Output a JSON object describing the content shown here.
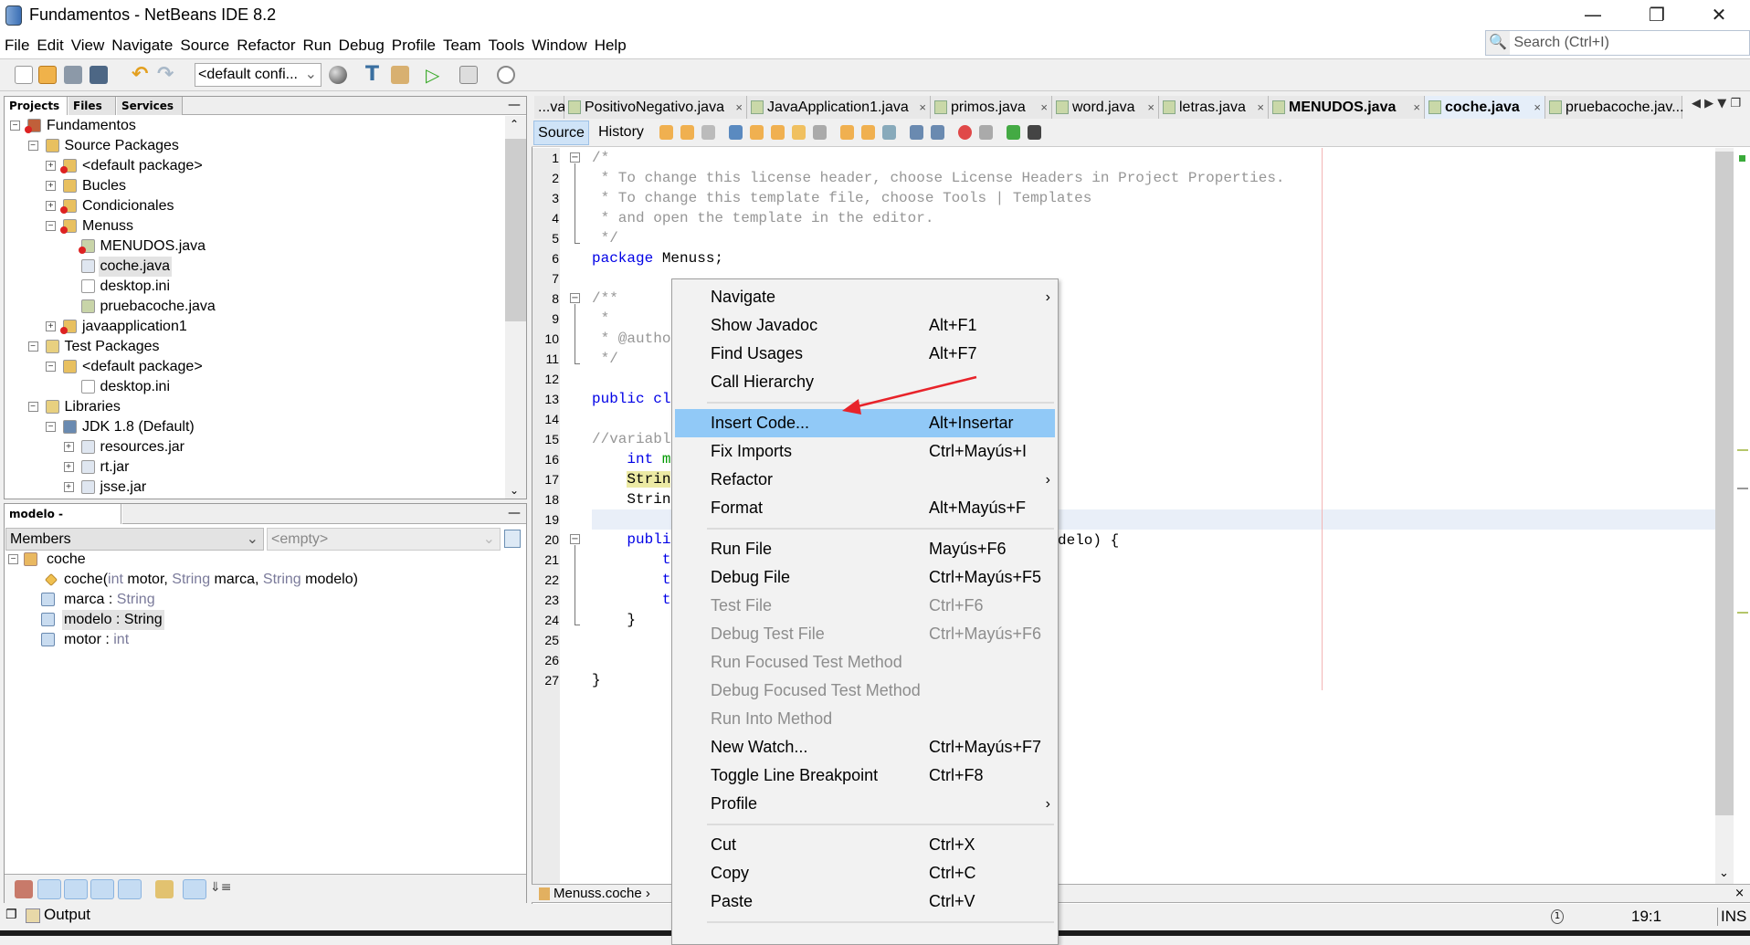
{
  "window": {
    "title": "Fundamentos - NetBeans IDE 8.2",
    "controls": [
      "minimize-icon",
      "restore-icon",
      "close-icon"
    ]
  },
  "menubar": [
    "File",
    "Edit",
    "View",
    "Navigate",
    "Source",
    "Refactor",
    "Run",
    "Debug",
    "Profile",
    "Team",
    "Tools",
    "Window",
    "Help"
  ],
  "search": {
    "placeholder": "Search (Ctrl+I)"
  },
  "toolbar": {
    "config": "<default confi..."
  },
  "projects_panel": {
    "tabs": [
      "Projects",
      "Files",
      "Services"
    ],
    "tree": [
      {
        "label": "Fundamentos",
        "depth": 0,
        "expander": "minus",
        "icon": "project"
      },
      {
        "label": "Source Packages",
        "depth": 1,
        "expander": "minus",
        "icon": "source-folder"
      },
      {
        "label": "<default package>",
        "depth": 2,
        "expander": "plus",
        "icon": "package-error"
      },
      {
        "label": "Bucles",
        "depth": 2,
        "expander": "plus",
        "icon": "package"
      },
      {
        "label": "Condicionales",
        "depth": 2,
        "expander": "plus",
        "icon": "package-error"
      },
      {
        "label": "Menuss",
        "depth": 2,
        "expander": "minus",
        "icon": "package-error"
      },
      {
        "label": "MENUDOS.java",
        "depth": 3,
        "expander": "",
        "icon": "java-main-error"
      },
      {
        "label": "coche.java",
        "depth": 3,
        "expander": "",
        "icon": "java-class",
        "selected": true
      },
      {
        "label": "desktop.ini",
        "depth": 3,
        "expander": "",
        "icon": "ini-file"
      },
      {
        "label": "pruebacoche.java",
        "depth": 3,
        "expander": "",
        "icon": "java-main"
      },
      {
        "label": "javaapplication1",
        "depth": 2,
        "expander": "plus",
        "icon": "package-error"
      },
      {
        "label": "Test Packages",
        "depth": 1,
        "expander": "minus",
        "icon": "test-folder"
      },
      {
        "label": "<default package>",
        "depth": 2,
        "expander": "minus",
        "icon": "package"
      },
      {
        "label": "desktop.ini",
        "depth": 3,
        "expander": "",
        "icon": "ini-file"
      },
      {
        "label": "Libraries",
        "depth": 1,
        "expander": "minus",
        "icon": "library-folder"
      },
      {
        "label": "JDK 1.8 (Default)",
        "depth": 2,
        "expander": "minus",
        "icon": "jdk"
      },
      {
        "label": "resources.jar",
        "depth": 3,
        "expander": "plus",
        "icon": "jar"
      },
      {
        "label": "rt.jar",
        "depth": 3,
        "expander": "plus",
        "icon": "jar"
      },
      {
        "label": "jsse.jar",
        "depth": 3,
        "expander": "plus",
        "icon": "jar"
      }
    ]
  },
  "navigator": {
    "tab": "modelo - Navigator",
    "filter": "Members",
    "second_combo": "<empty>",
    "tree": [
      {
        "name": "coche",
        "type": ""
      },
      {
        "name": "coche(",
        "type": "",
        "sig": [
          [
            "int",
            "g"
          ],
          [
            " motor, ",
            "b"
          ],
          [
            "String",
            "g"
          ],
          [
            " marca, ",
            "b"
          ],
          [
            "String",
            "g"
          ],
          [
            " modelo)",
            "b"
          ]
        ]
      },
      {
        "name": "marca",
        "type": "String"
      },
      {
        "name": "modelo",
        "type": "String",
        "selected": true
      },
      {
        "name": "motor",
        "type": "int"
      }
    ]
  },
  "output": {
    "label": "Output"
  },
  "editor": {
    "tabs": [
      {
        "label": "...va"
      },
      {
        "label": "PositivoNegativo.java"
      },
      {
        "label": "JavaApplication1.java"
      },
      {
        "label": "primos.java"
      },
      {
        "label": "word.java"
      },
      {
        "label": "letras.java"
      },
      {
        "label": "MENUDOS.java",
        "bold": true
      },
      {
        "label": "coche.java",
        "active": true
      },
      {
        "label": "pruebacoche.jav..."
      }
    ],
    "source_tab": "Source",
    "history_tab": "History",
    "lines": [
      [
        [
          "/*",
          "cm"
        ]
      ],
      [
        [
          " * To change this license header, choose License Headers in Project Properties.",
          "cm"
        ]
      ],
      [
        [
          " * To change this template file, choose Tools | Templates",
          "cm"
        ]
      ],
      [
        [
          " * and open the template in the editor.",
          "cm"
        ]
      ],
      [
        [
          " */",
          "cm"
        ]
      ],
      [
        [
          "package",
          "kw"
        ],
        [
          " Menuss;",
          ""
        ]
      ],
      [],
      [
        [
          "/**",
          "cm"
        ]
      ],
      [
        [
          " *",
          "cm"
        ]
      ],
      [
        [
          " * @autho",
          "cm"
        ]
      ],
      [
        [
          " */",
          "cm"
        ]
      ],
      [],
      [
        [
          "public cl",
          "kw"
        ]
      ],
      [],
      [
        [
          "//variabl",
          "cm"
        ]
      ],
      [
        [
          "    ",
          ""
        ],
        [
          "int",
          "kw"
        ],
        [
          " m",
          "fd"
        ]
      ],
      [
        [
          "    ",
          ""
        ],
        [
          "Strin",
          "hlw"
        ]
      ],
      [
        [
          "    Strin",
          ""
        ]
      ],
      [],
      [
        [
          "    ",
          ""
        ],
        [
          "publi",
          "kw"
        ]
      ],
      [
        [
          "        ",
          ""
        ],
        [
          "t",
          "kw"
        ]
      ],
      [
        [
          "        ",
          ""
        ],
        [
          "t",
          "kw"
        ]
      ],
      [
        [
          "        ",
          ""
        ],
        [
          "t",
          "kw"
        ]
      ],
      [
        [
          "    }",
          ""
        ]
      ],
      [],
      [],
      [
        [
          "}",
          ""
        ]
      ]
    ],
    "line20_tail": "delo) {",
    "current_line": 19,
    "breadcrumb": "Menuss.coche"
  },
  "status": {
    "position": "19:1",
    "mode": "INS",
    "notifications": "1"
  },
  "context_menu": [
    {
      "label": "Navigate",
      "submenu": true
    },
    {
      "label": "Show Javadoc",
      "shortcut": "Alt+F1"
    },
    {
      "label": "Find Usages",
      "shortcut": "Alt+F7"
    },
    {
      "label": "Call Hierarchy"
    },
    {
      "separator": true
    },
    {
      "label": "Insert Code...",
      "shortcut": "Alt+Insertar",
      "highlighted": true
    },
    {
      "label": "Fix Imports",
      "shortcut": "Ctrl+Mayús+I"
    },
    {
      "label": "Refactor",
      "submenu": true
    },
    {
      "label": "Format",
      "shortcut": "Alt+Mayús+F"
    },
    {
      "separator": true
    },
    {
      "label": "Run File",
      "shortcut": "Mayús+F6"
    },
    {
      "label": "Debug File",
      "shortcut": "Ctrl+Mayús+F5"
    },
    {
      "label": "Test File",
      "shortcut": "Ctrl+F6",
      "disabled": true
    },
    {
      "label": "Debug Test File",
      "shortcut": "Ctrl+Mayús+F6",
      "disabled": true
    },
    {
      "label": "Run Focused Test Method",
      "disabled": true
    },
    {
      "label": "Debug Focused Test Method",
      "disabled": true
    },
    {
      "label": "Run Into Method",
      "disabled": true
    },
    {
      "label": "New Watch...",
      "shortcut": "Ctrl+Mayús+F7"
    },
    {
      "label": "Toggle Line Breakpoint",
      "shortcut": "Ctrl+F8"
    },
    {
      "label": "Profile",
      "submenu": true
    },
    {
      "separator": true
    },
    {
      "label": "Cut",
      "shortcut": "Ctrl+X"
    },
    {
      "label": "Copy",
      "shortcut": "Ctrl+C"
    },
    {
      "label": "Paste",
      "shortcut": "Ctrl+V"
    },
    {
      "separator": true
    }
  ],
  "annotation": {
    "arrow_color": "#e8232a",
    "points_to": "Insert Code..."
  },
  "colors": {
    "menu_highlight": "#91c9f7",
    "keyword": "#0000e6",
    "comment": "#969696",
    "field": "#009900",
    "current_line": "#e9eff8",
    "occurrence": "#eceaa4"
  }
}
